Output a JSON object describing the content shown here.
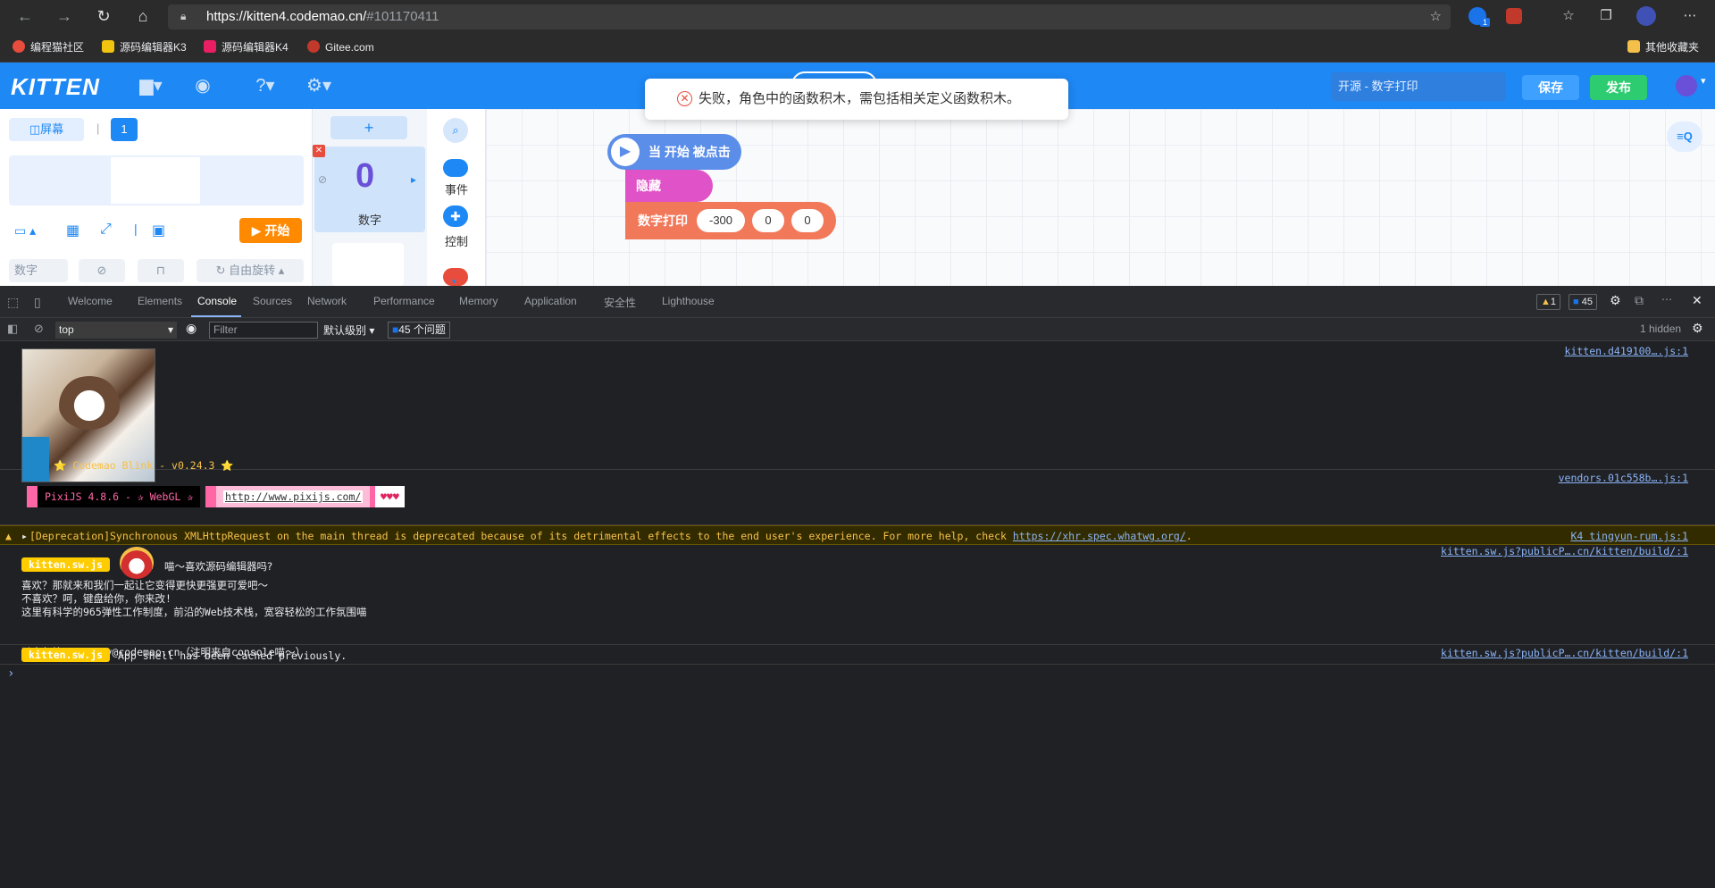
{
  "browser": {
    "url_host": "https://kitten4.codemao.cn/",
    "url_rest": "#101170411",
    "notif_count": "1",
    "bookmarks": [
      "编程猫社区",
      "源码编辑器K3",
      "源码编辑器K4",
      "Gitee.com"
    ],
    "other_bookmarks": "其他收藏夹"
  },
  "app": {
    "logo": "KITTEN",
    "project_name": "开源 - 数字打印",
    "save": "保存",
    "publish": "发布",
    "toast": "失败，角色中的函数积木，需包括相关定义函数积木。",
    "stage": {
      "screen_btn": "屏幕",
      "screen_num": "1",
      "start_btn": "开始",
      "prop_name": "数字",
      "rotate_label": "自由旋转"
    },
    "sprite": {
      "add": "+",
      "glyph": "0",
      "name": "数字"
    },
    "categories": [
      "事件",
      "控制"
    ],
    "blocks": {
      "hat": "当 开始 被点击",
      "hide": "隐藏",
      "print_label": "数字打印",
      "args": [
        "-300",
        "0",
        "0"
      ]
    }
  },
  "devtools": {
    "tabs": [
      "Welcome",
      "Elements",
      "Console",
      "Sources",
      "Network",
      "Performance",
      "Memory",
      "Application",
      "安全性",
      "Lighthouse"
    ],
    "warn_count": "1",
    "issue_count": "45",
    "context": "top",
    "filter_placeholder": "Filter",
    "level": "默认级别",
    "issues": "45 个问题",
    "hidden": "1 hidden",
    "log1": {
      "text": "⭐ Codemao Blink - v0.24.3 ⭐",
      "src": "kitten.d419100….js:1"
    },
    "log2": {
      "pixi": "PixiJS 4.8.6 - ✰ WebGL ✰",
      "link": "http://www.pixijs.com/",
      "hearts": "♥♥♥",
      "src": "vendors.01c558b….js:1"
    },
    "warning": {
      "text": "[Deprecation]Synchronous XMLHttpRequest on the main thread is deprecated because of its detrimental effects to the end user's experience. For more help, check ",
      "link": "https://xhr.spec.whatwg.org/",
      "tail": ".",
      "src": "K4  tingyun-rum.js:1"
    },
    "log3": {
      "tag": "kitten.sw.js",
      "title": "喵～喜欢源码编辑器吗?",
      "lines": [
        "喜欢？那就来和我们一起让它变得更快更强更可爱吧～",
        "不喜欢？呵，键盘给你，你来改!",
        "这里有科学的965弹性工作制度，前沿的Web技术栈，宽容轻松的工作氛围喵",
        "",
        "谜之邮箱: credev@codemao.cn（注明来自console喵～）"
      ],
      "src": "kitten.sw.js?publicP….cn/kitten/build/:1"
    },
    "log4": {
      "tag": "kitten.sw.js",
      "text": "App shell has been cached previously.",
      "src": "kitten.sw.js?publicP….cn/kitten/build/:1"
    },
    "prompt": "›"
  }
}
